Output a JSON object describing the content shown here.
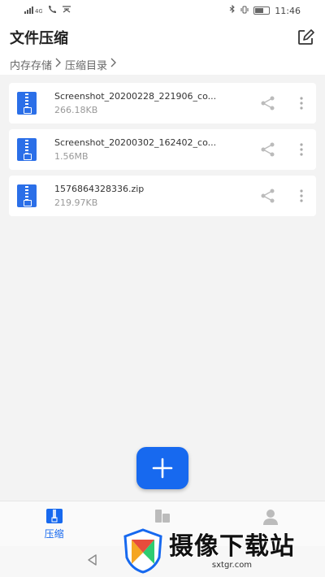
{
  "statusbar": {
    "time": "11:46"
  },
  "header": {
    "title": "文件压缩"
  },
  "breadcrumb": [
    "内存存储",
    "压缩目录"
  ],
  "files": [
    {
      "name": "Screenshot_20200228_221906_co...",
      "size": "266.18KB"
    },
    {
      "name": "Screenshot_20200302_162402_co...",
      "size": "1.56MB"
    },
    {
      "name": "1576864328336.zip",
      "size": "219.97KB"
    }
  ],
  "bottomnav": {
    "compress_label": "压缩"
  },
  "watermark": {
    "main": "摄像下载站",
    "sub": "sxtgr.com"
  },
  "colors": {
    "accent": "#1769ef",
    "background": "#f3f3f3"
  }
}
